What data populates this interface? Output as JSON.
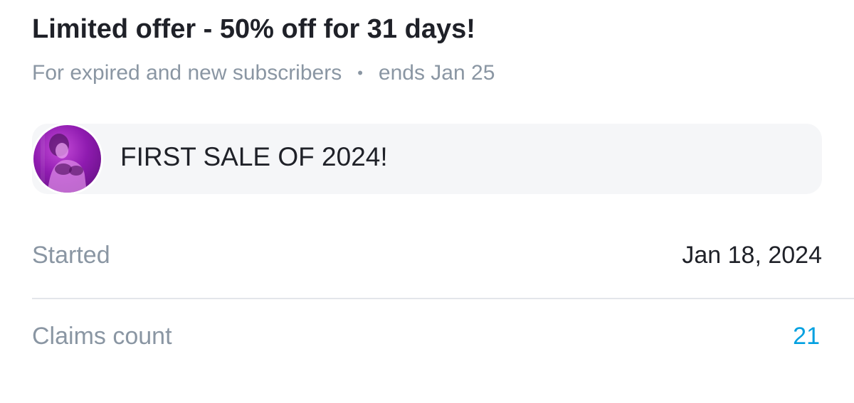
{
  "offer": {
    "title": "Limited offer - 50% off for 31 days!",
    "audience": "For expired and new subscribers",
    "separator": "•",
    "ends": "ends Jan 25"
  },
  "message": {
    "avatar_icon": "avatar",
    "text": "FIRST SALE OF 2024!"
  },
  "details": {
    "started_label": "Started",
    "started_value": "Jan 18, 2024",
    "claims_label": "Claims count",
    "claims_value": "21"
  },
  "colors": {
    "primary_text": "#1f2128",
    "secondary_text": "#8a96a3",
    "accent": "#00a0e0",
    "card_bg": "#f5f6f8",
    "divider": "#e3e6ea"
  }
}
